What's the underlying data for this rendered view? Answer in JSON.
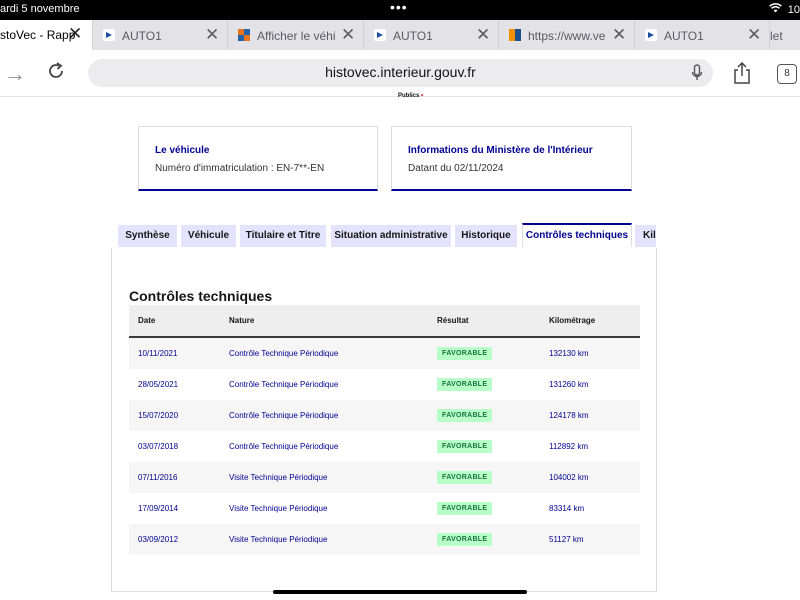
{
  "status_bar": {
    "date": "ardi 5 novembre",
    "dots": "•••",
    "time_partial": "10"
  },
  "tabs": [
    {
      "title": "stoVec - Rapp",
      "icon": "histovec-icon",
      "active": true
    },
    {
      "title": "AUTO1",
      "icon": "auto1-icon",
      "active": false
    },
    {
      "title": "Afficher le véhi",
      "icon": "colorful-grid-icon",
      "active": false
    },
    {
      "title": "AUTO1",
      "icon": "auto1-icon",
      "active": false
    },
    {
      "title": "https://www.ve",
      "icon": "orange-blue-icon",
      "active": false
    },
    {
      "title": "AUTO1",
      "icon": "auto1-icon",
      "active": false
    },
    {
      "title": "let",
      "icon": "",
      "active": false
    }
  ],
  "toolbar": {
    "url": "histovec.interieur.gouv.fr",
    "tab_count": "8"
  },
  "logo_remnant": {
    "text": "Publics",
    "mark": "•"
  },
  "cards": [
    {
      "title": "Le véhicule",
      "text": "Numéro d'immatriculation : EN-7**-EN"
    },
    {
      "title": "Informations du Ministère de l'Intérieur",
      "text": "Datant du 02/11/2024"
    }
  ],
  "panel_tabs": [
    {
      "label": "Synthèse",
      "active": false
    },
    {
      "label": "Véhicule",
      "active": false
    },
    {
      "label": "Titulaire et Titre",
      "active": false
    },
    {
      "label": "Situation administrative",
      "active": false
    },
    {
      "label": "Historique",
      "active": false
    },
    {
      "label": "Contrôles techniques",
      "active": true
    },
    {
      "label": "Kilo",
      "active": false
    }
  ],
  "section": {
    "title": "Contrôles techniques",
    "columns": [
      "Date",
      "Nature",
      "Résultat",
      "Kilométrage"
    ],
    "rows": [
      {
        "date": "10/11/2021",
        "nature": "Contrôle Technique Périodique",
        "result": "FAVORABLE",
        "km": "132130 km"
      },
      {
        "date": "28/05/2021",
        "nature": "Contrôle Technique Périodique",
        "result": "FAVORABLE",
        "km": "131260 km"
      },
      {
        "date": "15/07/2020",
        "nature": "Contrôle Technique Périodique",
        "result": "FAVORABLE",
        "km": "124178 km"
      },
      {
        "date": "03/07/2018",
        "nature": "Contrôle Technique Périodique",
        "result": "FAVORABLE",
        "km": "112892 km"
      },
      {
        "date": "07/11/2016",
        "nature": "Visite Technique Périodique",
        "result": "FAVORABLE",
        "km": "104002 km"
      },
      {
        "date": "17/09/2014",
        "nature": "Visite Technique Périodique",
        "result": "FAVORABLE",
        "km": "83314 km"
      },
      {
        "date": "03/09/2012",
        "nature": "Visite Technique Périodique",
        "result": "FAVORABLE",
        "km": "51127 km"
      }
    ]
  },
  "colors": {
    "accent": "#000091",
    "badge_bg": "#b8fec9",
    "badge_text": "#18753c",
    "tab_bg": "#e3e3fd"
  }
}
